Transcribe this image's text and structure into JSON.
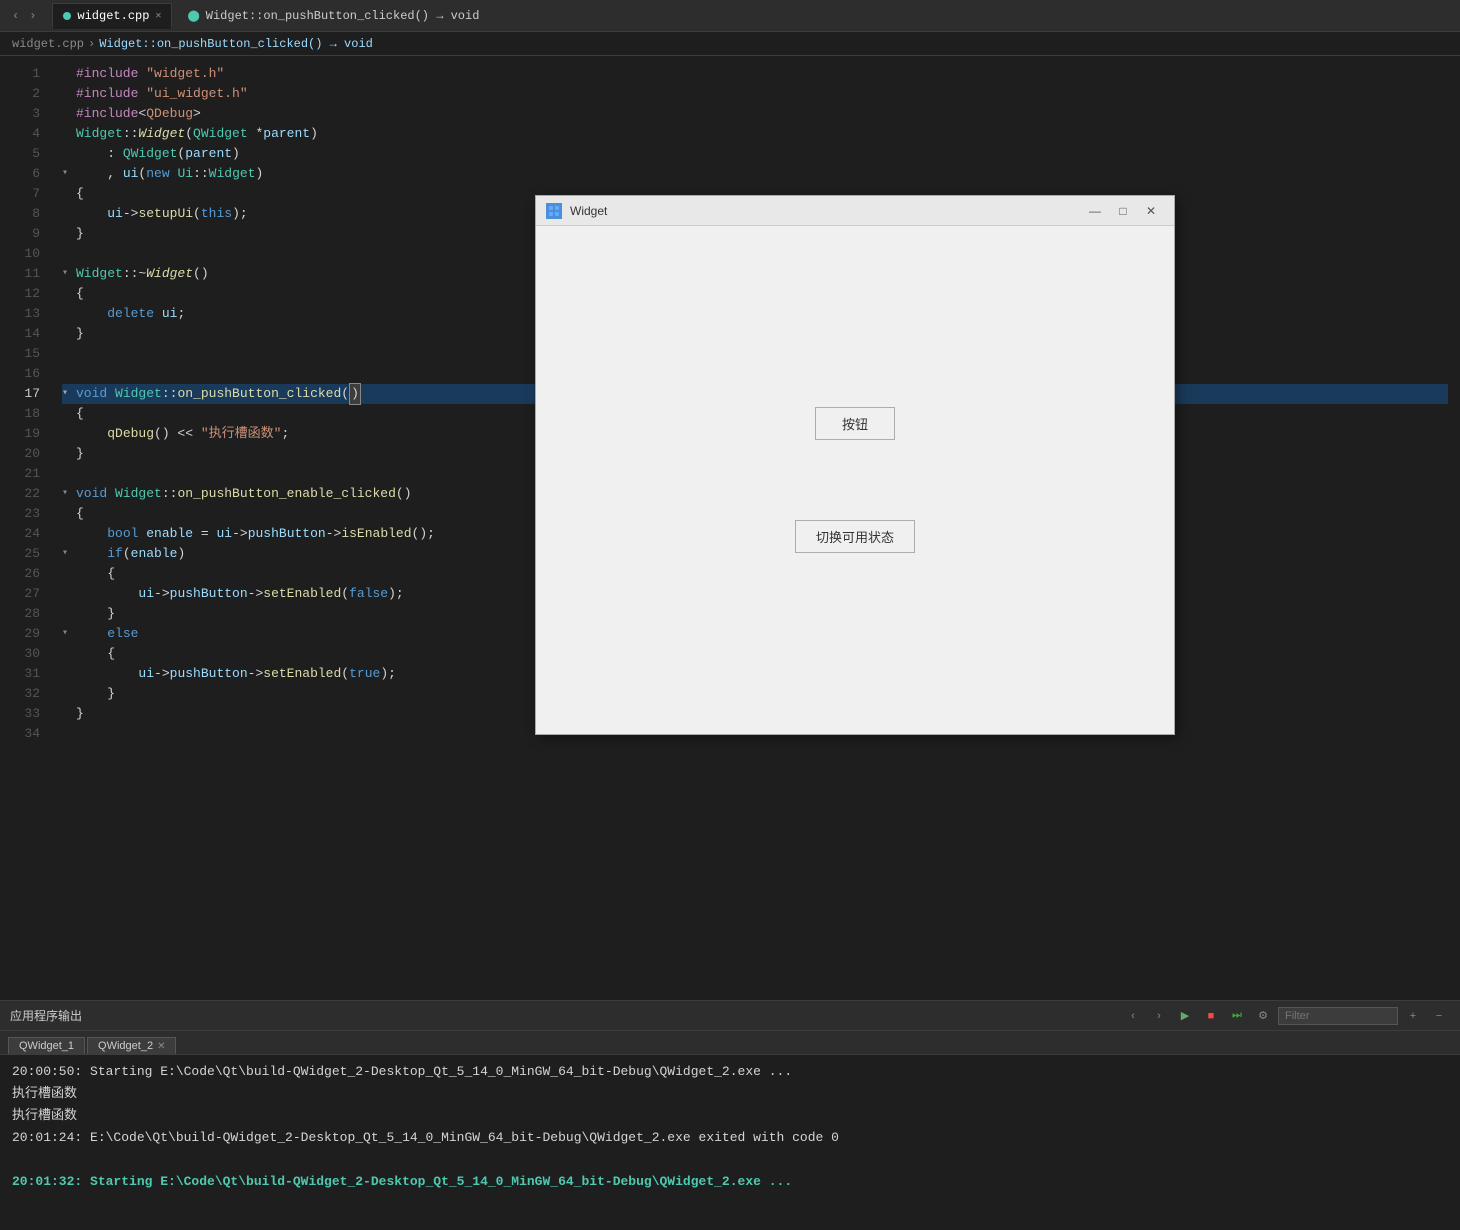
{
  "tabs": [
    {
      "label": "widget.cpp",
      "active": true,
      "icon": true
    },
    {
      "label": "Widget::on_pushButton_clicked() → void",
      "active": false,
      "icon": false
    }
  ],
  "breadcrumb": {
    "file": "widget.cpp",
    "arrow1": "›",
    "func": "Widget::on_pushButton_clicked() → void"
  },
  "code": {
    "lines": [
      {
        "num": 1,
        "content": "#include \"widget.h\"",
        "type": "include"
      },
      {
        "num": 2,
        "content": "#include \"ui_widget.h\"",
        "type": "include"
      },
      {
        "num": 3,
        "content": "#include<QDebug>",
        "type": "include"
      },
      {
        "num": 4,
        "content": "Widget::Widget(QWidget *parent)",
        "type": "constructor"
      },
      {
        "num": 5,
        "content": "    : QWidget(parent)",
        "type": "init"
      },
      {
        "num": 6,
        "content": "    , ui(new Ui::Widget)",
        "type": "init",
        "fold": true
      },
      {
        "num": 7,
        "content": "{",
        "type": "brace"
      },
      {
        "num": 8,
        "content": "    ui->setupUi(this);",
        "type": "code"
      },
      {
        "num": 9,
        "content": "}",
        "type": "brace"
      },
      {
        "num": 10,
        "content": "",
        "type": "empty"
      },
      {
        "num": 11,
        "content": "Widget::~Widget()",
        "type": "destructor",
        "fold": true
      },
      {
        "num": 12,
        "content": "{",
        "type": "brace"
      },
      {
        "num": 13,
        "content": "    delete ui;",
        "type": "code"
      },
      {
        "num": 14,
        "content": "}",
        "type": "brace"
      },
      {
        "num": 15,
        "content": "",
        "type": "empty"
      },
      {
        "num": 16,
        "content": "",
        "type": "empty"
      },
      {
        "num": 17,
        "content": "void Widget::on_pushButton_clicked()",
        "type": "function",
        "fold": true,
        "highlight": true
      },
      {
        "num": 18,
        "content": "{",
        "type": "brace"
      },
      {
        "num": 19,
        "content": "    qDebug() << \"执行槽函数\";",
        "type": "code"
      },
      {
        "num": 20,
        "content": "}",
        "type": "brace"
      },
      {
        "num": 21,
        "content": "",
        "type": "empty"
      },
      {
        "num": 22,
        "content": "void Widget::on_pushButton_enable_clicked()",
        "type": "function",
        "fold": true
      },
      {
        "num": 23,
        "content": "{",
        "type": "brace"
      },
      {
        "num": 24,
        "content": "    bool enable = ui->pushButton->isEnabled();",
        "type": "code"
      },
      {
        "num": 25,
        "content": "    if(enable)",
        "type": "code",
        "fold": true
      },
      {
        "num": 26,
        "content": "    {",
        "type": "brace"
      },
      {
        "num": 27,
        "content": "        ui->pushButton->setEnabled(false);",
        "type": "code"
      },
      {
        "num": 28,
        "content": "    }",
        "type": "brace"
      },
      {
        "num": 29,
        "content": "    else",
        "type": "code",
        "fold": true
      },
      {
        "num": 30,
        "content": "    {",
        "type": "brace"
      },
      {
        "num": 31,
        "content": "        ui->pushButton->setEnabled(true);",
        "type": "code"
      },
      {
        "num": 32,
        "content": "    }",
        "type": "brace"
      },
      {
        "num": 33,
        "content": "}",
        "type": "brace"
      },
      {
        "num": 34,
        "content": "",
        "type": "empty"
      }
    ]
  },
  "widget_window": {
    "title": "Widget",
    "button1_label": "按钮",
    "button2_label": "切换可用状态",
    "min_label": "—",
    "max_label": "□",
    "close_label": "✕"
  },
  "output_panel": {
    "title": "应用程序输出",
    "filter_placeholder": "Filter",
    "tabs": [
      {
        "label": "QWidget_1",
        "closable": false
      },
      {
        "label": "QWidget_2",
        "closable": true
      }
    ],
    "lines": [
      {
        "text": "20:00:50: Starting E:\\Code\\Qt\\build-QWidget_2-Desktop_Qt_5_14_0_MinGW_64_bit-Debug\\QWidget_2.exe ...",
        "style": "normal"
      },
      {
        "text": "执行槽函数",
        "style": "normal"
      },
      {
        "text": "执行槽函数",
        "style": "normal"
      },
      {
        "text": "20:01:24: E:\\Code\\Qt\\build-QWidget_2-Desktop_Qt_5_14_0_MinGW_64_bit-Debug\\QWidget_2.exe exited with code 0",
        "style": "normal"
      },
      {
        "text": "",
        "style": "normal"
      },
      {
        "text": "20:01:32: Starting E:\\Code\\Qt\\build-QWidget_2-Desktop_Qt_5_14_0_MinGW_64_bit-Debug\\QWidget_2.exe ...",
        "style": "bold-green"
      }
    ]
  },
  "icons": {
    "fold": "▾",
    "fold_right": "▸",
    "nav_left": "‹",
    "nav_right": "›",
    "search": "🔍",
    "play": "▶",
    "stop": "■",
    "step": "⏭",
    "settings": "⚙"
  }
}
